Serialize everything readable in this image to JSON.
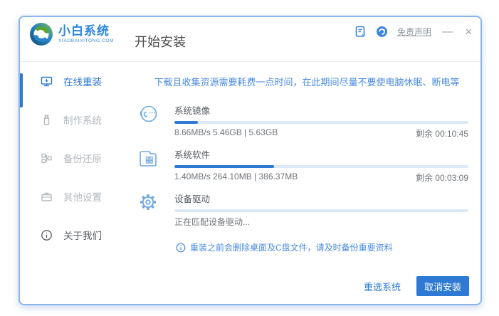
{
  "brand": {
    "name": "小白系统",
    "domain": "XIAOBAIXITONG.COM"
  },
  "header": {
    "page_title": "开始安装",
    "disclaimer_link": "免责声明",
    "minimize_glyph": "—",
    "close_glyph": "×"
  },
  "sidebar": {
    "items": [
      {
        "label": "在线重装",
        "active": true
      },
      {
        "label": "制作系统",
        "active": false
      },
      {
        "label": "备份还原",
        "active": false
      },
      {
        "label": "其他设置",
        "active": false
      },
      {
        "label": "关于我们",
        "active": false
      }
    ]
  },
  "main": {
    "notice": "下载且收集资源需要耗费一点时间，在此期间尽量不要使电脑休眠、断电等",
    "tasks": [
      {
        "name": "系统镜像",
        "stats": "8.66MB/s 5.46GB | 5.63GB",
        "remaining": "剩余 00:10:45",
        "progress_pct": 8
      },
      {
        "name": "系统软件",
        "stats": "1.40MB/s 264.10MB | 386.37MB",
        "remaining": "剩余 00:03:09",
        "progress_pct": 34
      },
      {
        "name": "设备驱动",
        "stats": "正在匹配设备驱动...",
        "remaining": "",
        "progress_pct": 0
      }
    ],
    "warning": "重装之前会删除桌面及C盘文件，请及时备份重要资料",
    "footer_buttons": {
      "reselect": "重选系统",
      "cancel": "取消安装"
    }
  },
  "icons": {
    "titlebar_bill": "document-with-pen",
    "titlebar_support": "blue-swirl-circle",
    "online_reinstall": "monitor-download",
    "make_system": "usb-drive",
    "backup_restore": "linked-squares",
    "other_settings": "briefcase",
    "about_us": "info-circle",
    "task_system_image": "mascot-face",
    "task_system_software": "folder-apps",
    "task_device_driver": "gear",
    "warning": "info-circle"
  },
  "colors": {
    "accent_blue": "#2e79d4",
    "notice_blue": "#4a8be0",
    "icon_light_blue": "#6ea8e2",
    "progress_track": "#dde9f8",
    "inactive_gray": "#b3b8bd",
    "window_border": "#8ab6ec"
  }
}
